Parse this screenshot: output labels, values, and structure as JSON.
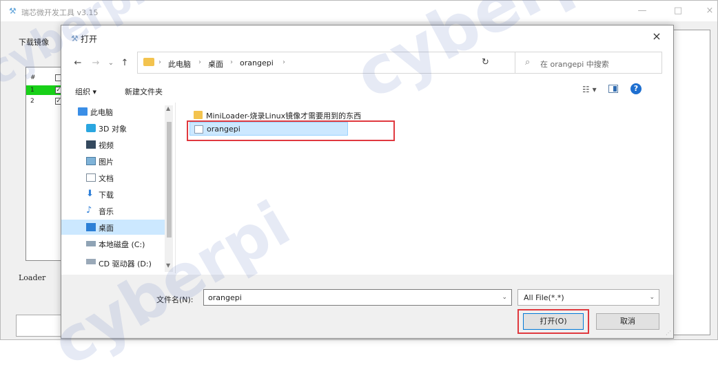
{
  "background_window": {
    "title": "瑞芯微开发工具 v3.15",
    "minimize": "—",
    "maximize": "□",
    "close": "×",
    "tab_label": "下载镜像",
    "table_header_num": "#",
    "rows": [
      {
        "num": "1",
        "checked": "✓"
      },
      {
        "num": "2",
        "checked": "✓"
      }
    ],
    "loader_label": "Loader"
  },
  "dialog": {
    "title": "打开",
    "close": "×",
    "nav": {
      "back": "←",
      "forward": "→",
      "recent": "⌄",
      "up": "↑"
    },
    "address": {
      "crumbs": [
        "此电脑",
        "桌面",
        "orangepi"
      ],
      "separator": "›",
      "dropdown": "⌄"
    },
    "refresh": "↻",
    "search_placeholder": "在 orangepi 中搜索",
    "toolbar": {
      "organize": "组织 ▾",
      "new_folder": "新建文件夹",
      "view": "☷ ▾",
      "help": "?"
    },
    "nav_pane": {
      "items": [
        {
          "label": "此电脑",
          "icon": "computer-icon"
        },
        {
          "label": "3D 对象",
          "icon": "3d-objects-icon"
        },
        {
          "label": "视频",
          "icon": "video-icon"
        },
        {
          "label": "图片",
          "icon": "pictures-icon"
        },
        {
          "label": "文档",
          "icon": "documents-icon"
        },
        {
          "label": "下载",
          "icon": "download-icon"
        },
        {
          "label": "音乐",
          "icon": "music-icon"
        },
        {
          "label": "桌面",
          "icon": "desktop-icon",
          "selected": true
        },
        {
          "label": "本地磁盘 (C:)",
          "icon": "drive-icon"
        },
        {
          "label": "CD 驱动器 (D:)",
          "icon": "cd-drive-icon"
        }
      ]
    },
    "files": [
      {
        "name": "MiniLoader-烧录Linux镜像才需要用到的东西",
        "type": "folder"
      },
      {
        "name": "orangepi",
        "type": "file",
        "selected": true
      }
    ],
    "filename_label": "文件名(N):",
    "filename_value": "orangepi",
    "filter_value": "All File(*.*)",
    "open_button": "打开(O)",
    "cancel_button": "取消"
  },
  "watermark": "cyberpi"
}
